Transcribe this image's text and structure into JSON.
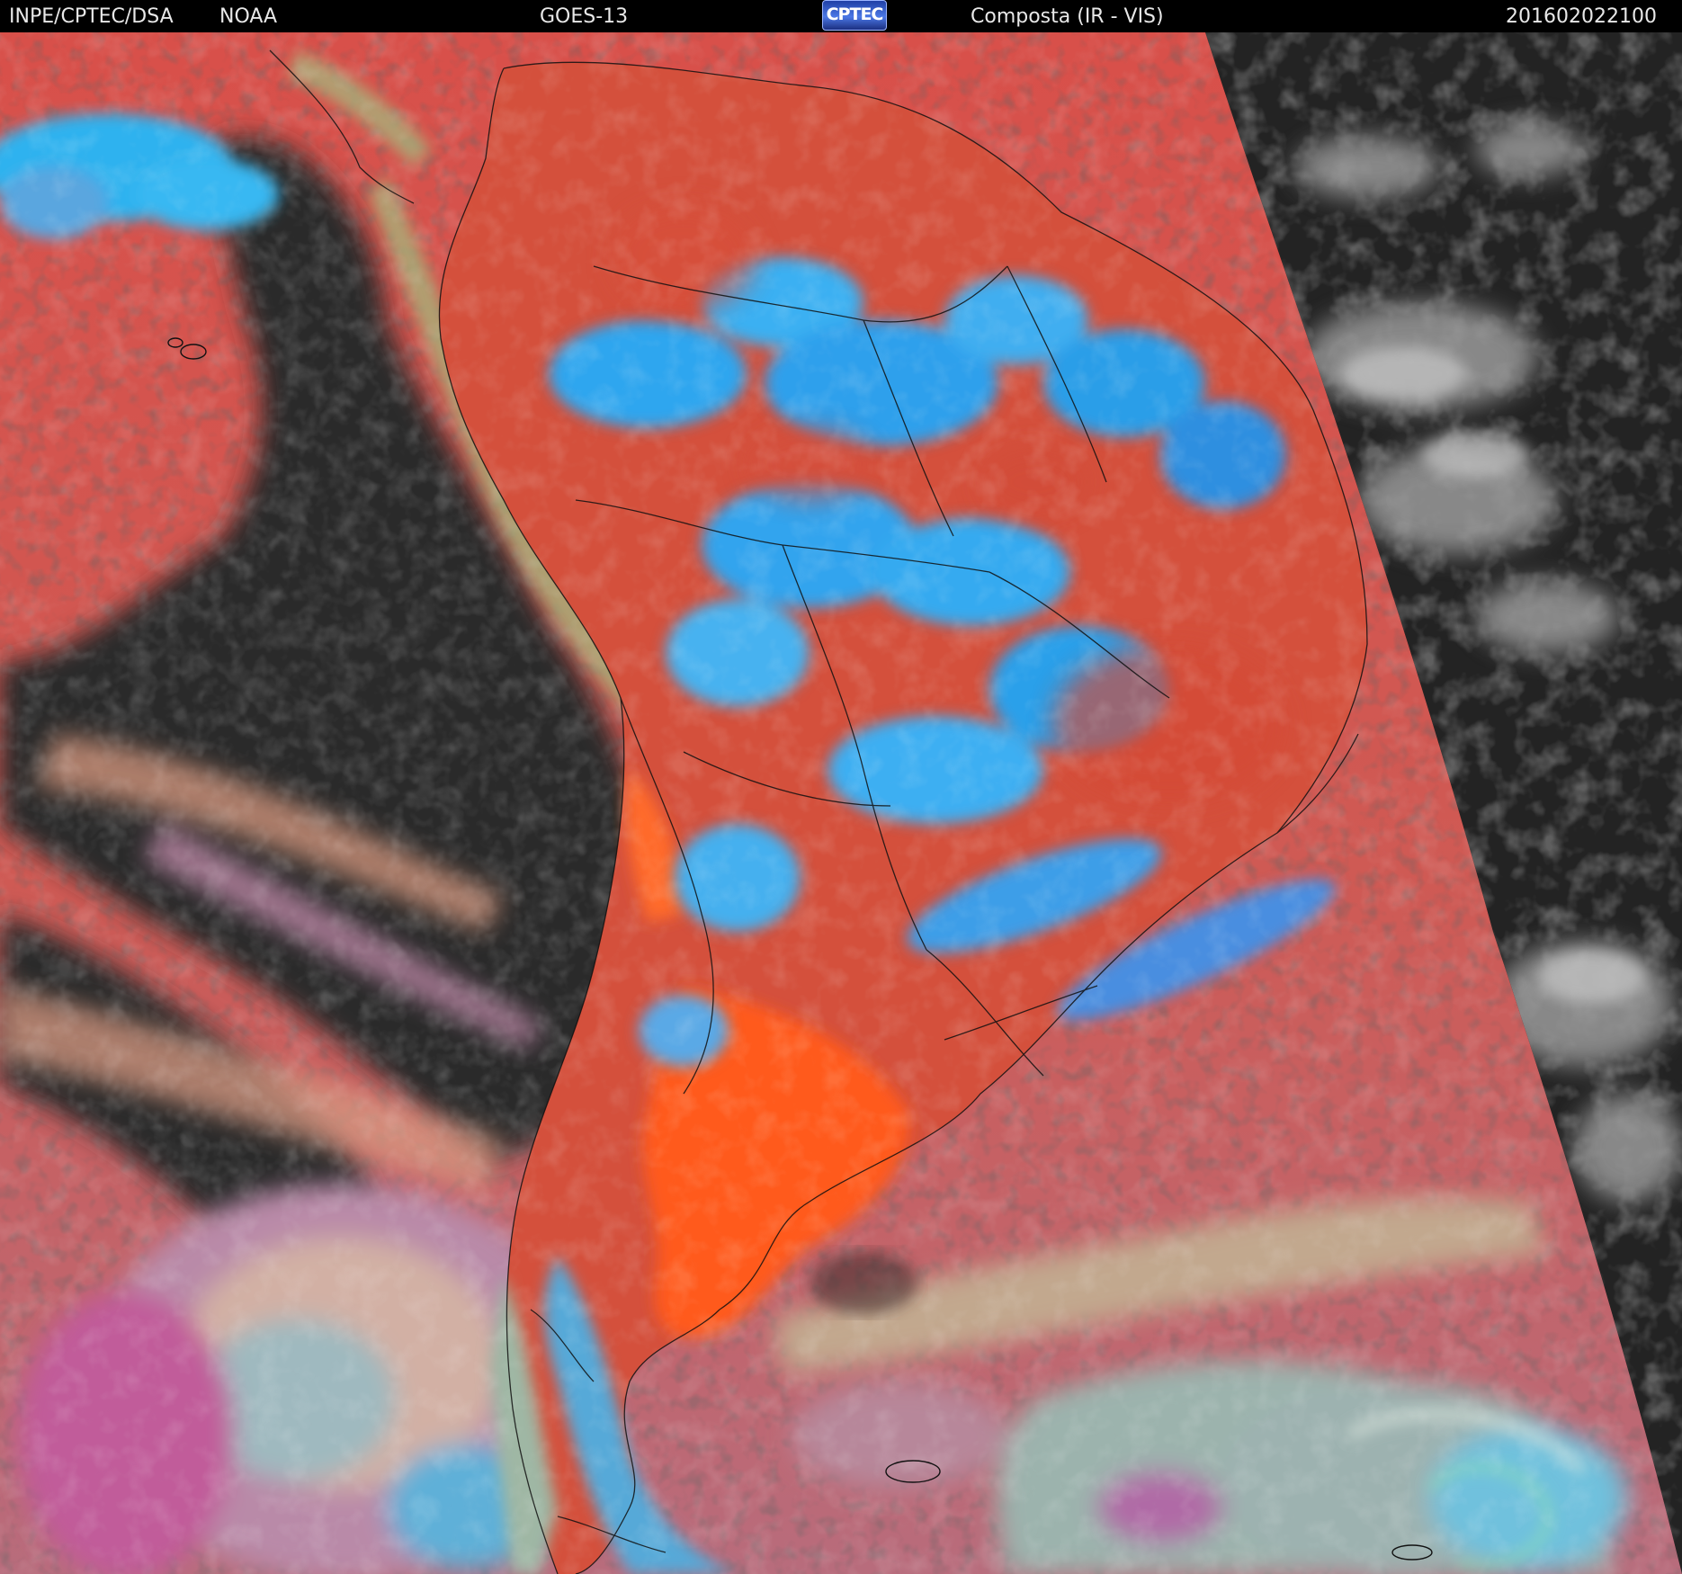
{
  "header": {
    "agency": "INPE/CPTEC/DSA",
    "partner": "NOAA",
    "satellite": "GOES-13",
    "logo_text": "CPTEC",
    "product": "Composta (IR - VIS)",
    "timestamp": "201602022100"
  },
  "colors": {
    "header_background": "#000000",
    "header_text": "#e8e8e8",
    "warm_surface": "#d9503e",
    "hot_land": "#ff5a1e",
    "cold_cloud": "#28a8f0",
    "clear_ocean": "#2b2b2b",
    "night_side": "#222222",
    "borders": "#101010"
  },
  "icons": {
    "logo": "cptec-logo"
  }
}
